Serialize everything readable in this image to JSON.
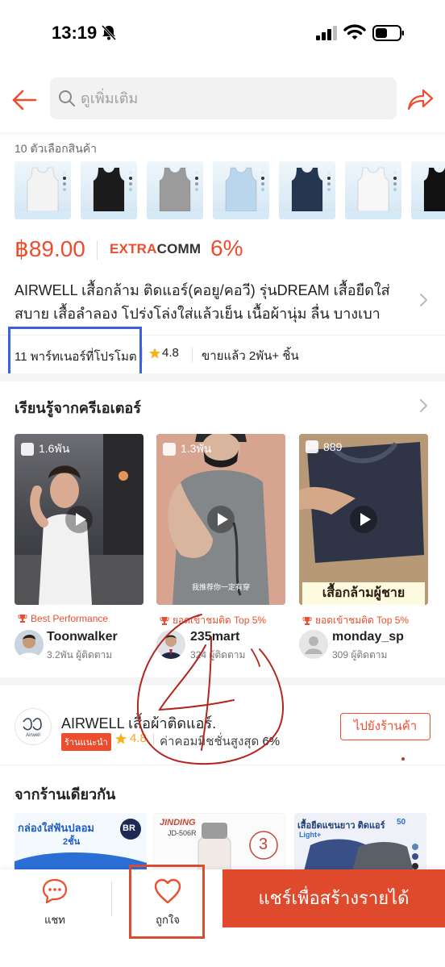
{
  "status_bar": {
    "time": "13:19"
  },
  "header": {
    "search_placeholder": "ดูเพิ่มเติม"
  },
  "product": {
    "options_label": "10 ตัวเลือกสินค้า",
    "variant_colors": [
      "#f3f3f3",
      "#1c1c1c",
      "#9b9b9b",
      "#b9d6ec",
      "#243650",
      "#f7f7f7",
      "#111111"
    ],
    "price": "฿89.00",
    "extra_word": "EXTRA",
    "comm_word": "COMM",
    "extra_comm_pct": "6%",
    "title": "AIRWELL เสื้อกล้าม ติดแอร์(คอยู/คอวี) รุ่นDREAM เสื้อยืดใส่สบาย เสื้อลำลอง โปร่งโล่งใส่แล้วเย็น เนื้อผ้านุ่ม ลื่น บางเบา",
    "partners_text": "11 พาร์ทเนอร์ที่โปรโมต",
    "rating": "4.8",
    "sold_text": "ขายแล้ว 2พัน+ ชิ้น"
  },
  "creators": {
    "heading": "เรียนรู้จากครีเอเตอร์",
    "items": [
      {
        "views": "1.6พัน",
        "badge": "Best Performance",
        "name": "Toonwalker",
        "followers": "3.2พัน ผู้ติดตาม",
        "caption": "",
        "overlay": ""
      },
      {
        "views": "1.3พัน",
        "badge": "ยอดเข้าชมติด Top 5%",
        "name": "235mart",
        "followers": "324 ผู้ติดตาม",
        "caption": "我推荐你一定有穿",
        "overlay": ""
      },
      {
        "views": "889",
        "badge": "ยอดเข้าชมติด Top 5%",
        "name": "monday_sp",
        "followers": "309 ผู้ติดตาม",
        "caption": "",
        "overlay": "เสื้อกล้ามผู้ชาย"
      }
    ]
  },
  "shop": {
    "name": "AIRWELL เสื้อผ้าติดแอร์.",
    "tag": "ร้านแนะนำ",
    "rating": "4.8",
    "commission_label": "ค่าคอมมิชชั่นสูงสุด",
    "commission_pct": "6%",
    "goto_label": "ไปยังร้านค้า",
    "logo_text": "Airwell"
  },
  "same_shop": {
    "heading": "จากร้านเดียวกัน",
    "cards": [
      {
        "line1": "กล่องใส่ฟันปลอม",
        "line2": "2ชั้น",
        "logo": "BR"
      },
      {
        "line1": "JINDING",
        "line2": "JD-506R",
        "badge": "3"
      },
      {
        "line1": "เสื้อยืดแขนยาว ติดแอร์",
        "line2": "Light+",
        "badge": "50"
      }
    ]
  },
  "bottom_bar": {
    "chat_label": "แชท",
    "like_label": "ถูกใจ",
    "share_label": "แชร์เพื่อสร้างรายได้"
  },
  "annotations": {
    "handwritten_number": "4"
  }
}
